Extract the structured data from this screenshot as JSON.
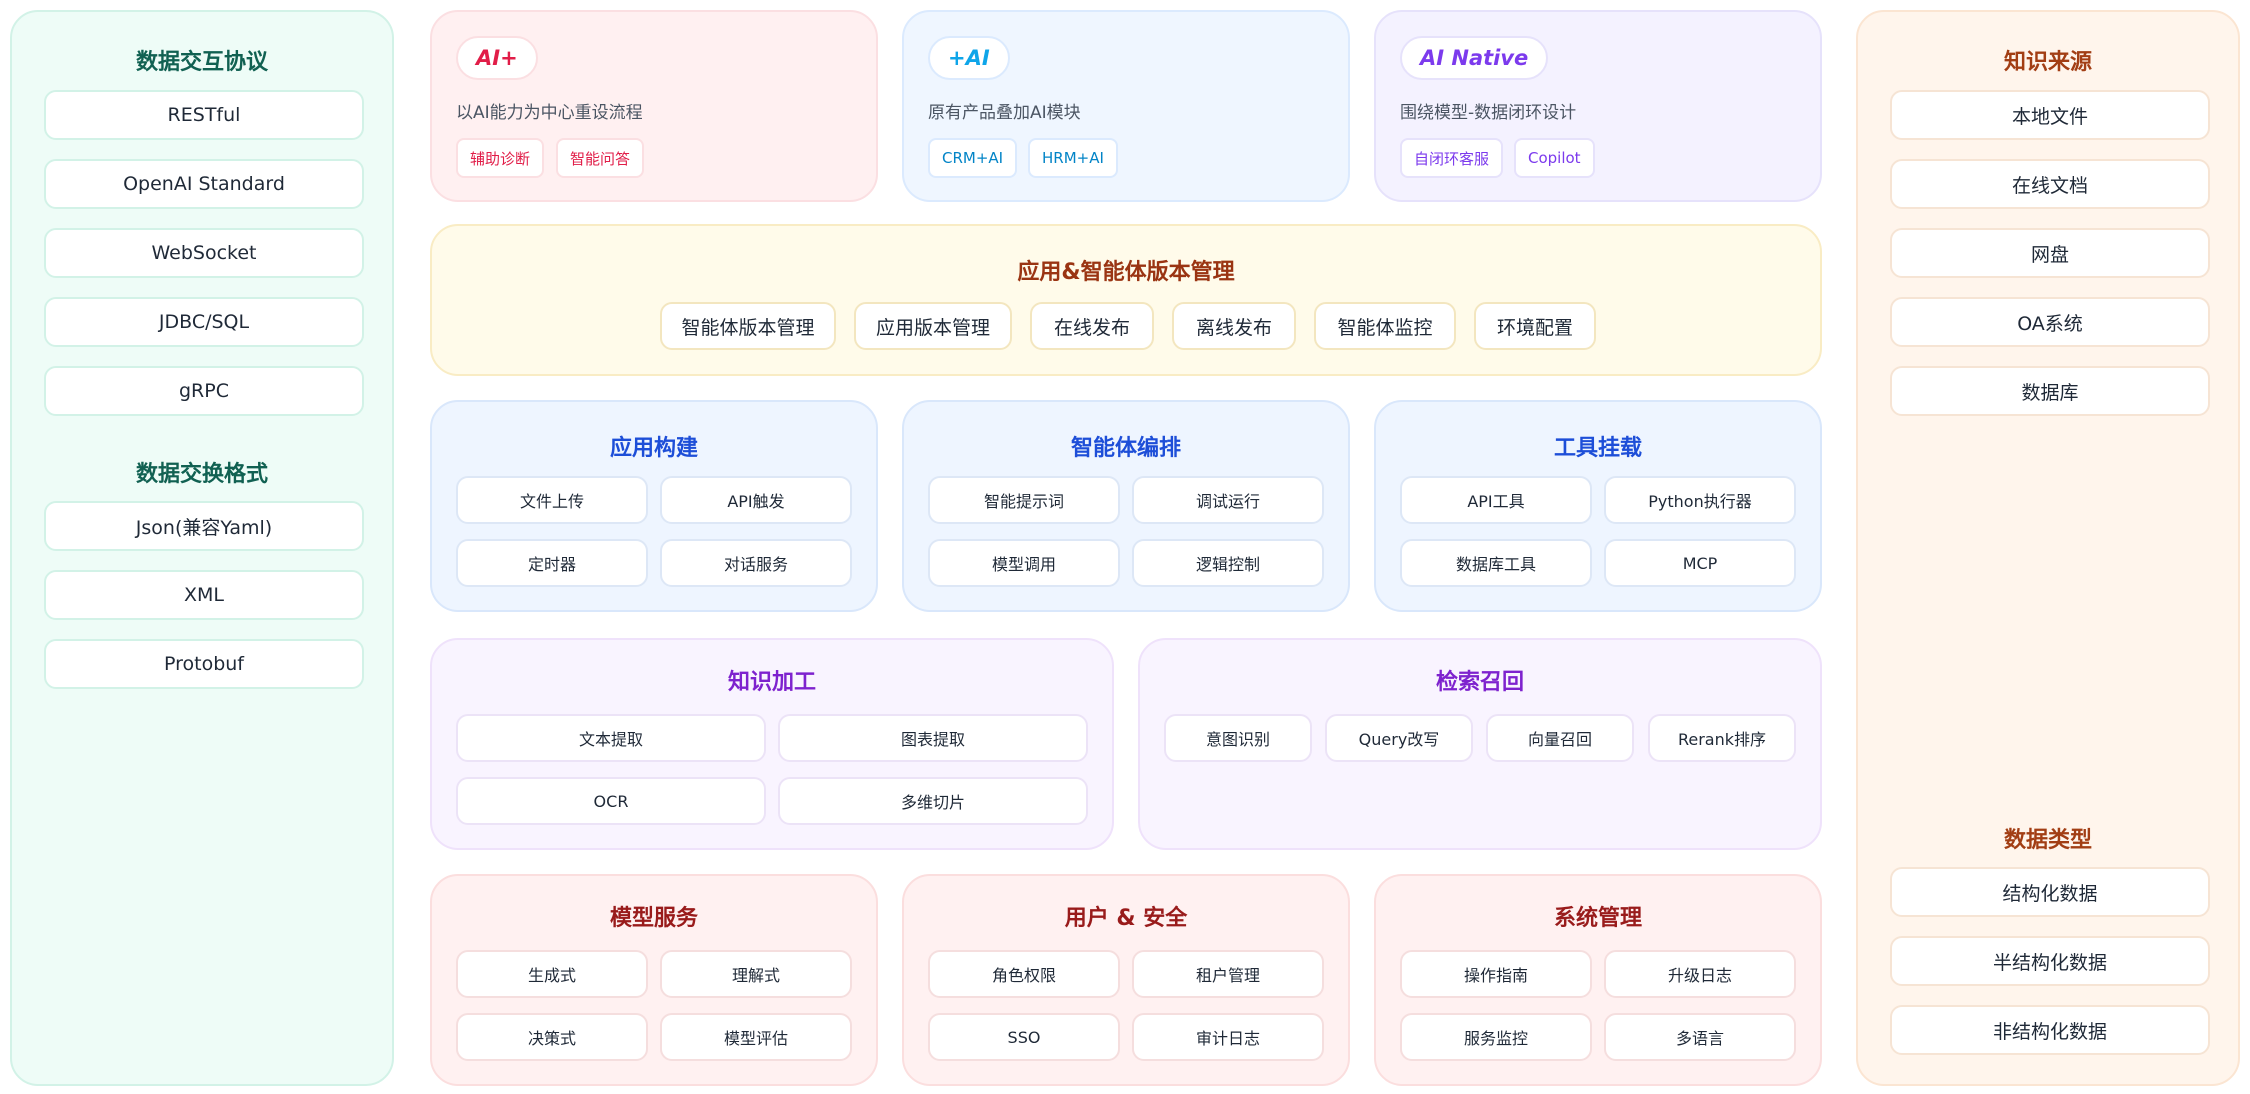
{
  "left": {
    "protocol_title": "数据交互协议",
    "protocols": [
      "RESTful",
      "OpenAI Standard",
      "WebSocket",
      "JDBC/SQL",
      "gRPC"
    ],
    "format_title": "数据交换格式",
    "formats": [
      "Json(兼容Yaml)",
      "XML",
      "Protobuf"
    ]
  },
  "right": {
    "source_title": "知识来源",
    "sources": [
      "本地文件",
      "在线文档",
      "网盘",
      "OA系统",
      "数据库"
    ],
    "type_title": "数据类型",
    "types": [
      "结构化数据",
      "半结构化数据",
      "非结构化数据"
    ]
  },
  "top": [
    {
      "badge": "AI+",
      "desc": "以AI能力为中心重设流程",
      "tags": [
        "辅助诊断",
        "智能问答"
      ]
    },
    {
      "badge": "+AI",
      "desc": "原有产品叠加AI模块",
      "tags": [
        "CRM+AI",
        "HRM+AI"
      ]
    },
    {
      "badge": "AI Native",
      "desc": "围绕模型-数据闭环设计",
      "tags": [
        "自闭环客服",
        "Copilot"
      ]
    }
  ],
  "version": {
    "title": "应用&智能体版本管理",
    "items": [
      "智能体版本管理",
      "应用版本管理",
      "在线发布",
      "离线发布",
      "智能体监控",
      "环境配置"
    ]
  },
  "app_build": {
    "title": "应用构建",
    "items": [
      "文件上传",
      "API触发",
      "定时器",
      "对话服务"
    ]
  },
  "agent_orch": {
    "title": "智能体编排",
    "items": [
      "智能提示词",
      "调试运行",
      "模型调用",
      "逻辑控制"
    ]
  },
  "tools": {
    "title": "工具挂载",
    "items": [
      "API工具",
      "Python执行器",
      "数据库工具",
      "MCP"
    ]
  },
  "knowledge": {
    "title": "知识加工",
    "items": [
      "文本提取",
      "图表提取",
      "OCR",
      "多维切片"
    ]
  },
  "retrieval": {
    "title": "检索召回",
    "items": [
      "意图识别",
      "Query改写",
      "向量召回",
      "Rerank排序"
    ]
  },
  "model_service": {
    "title": "模型服务",
    "items": [
      "生成式",
      "理解式",
      "决策式",
      "模型评估"
    ]
  },
  "user_security": {
    "title": "用户 & 安全",
    "items": [
      "角色权限",
      "租户管理",
      "SSO",
      "审计日志"
    ]
  },
  "system_mgmt": {
    "title": "系统管理",
    "items": [
      "操作指南",
      "升级日志",
      "服务监控",
      "多语言"
    ]
  }
}
